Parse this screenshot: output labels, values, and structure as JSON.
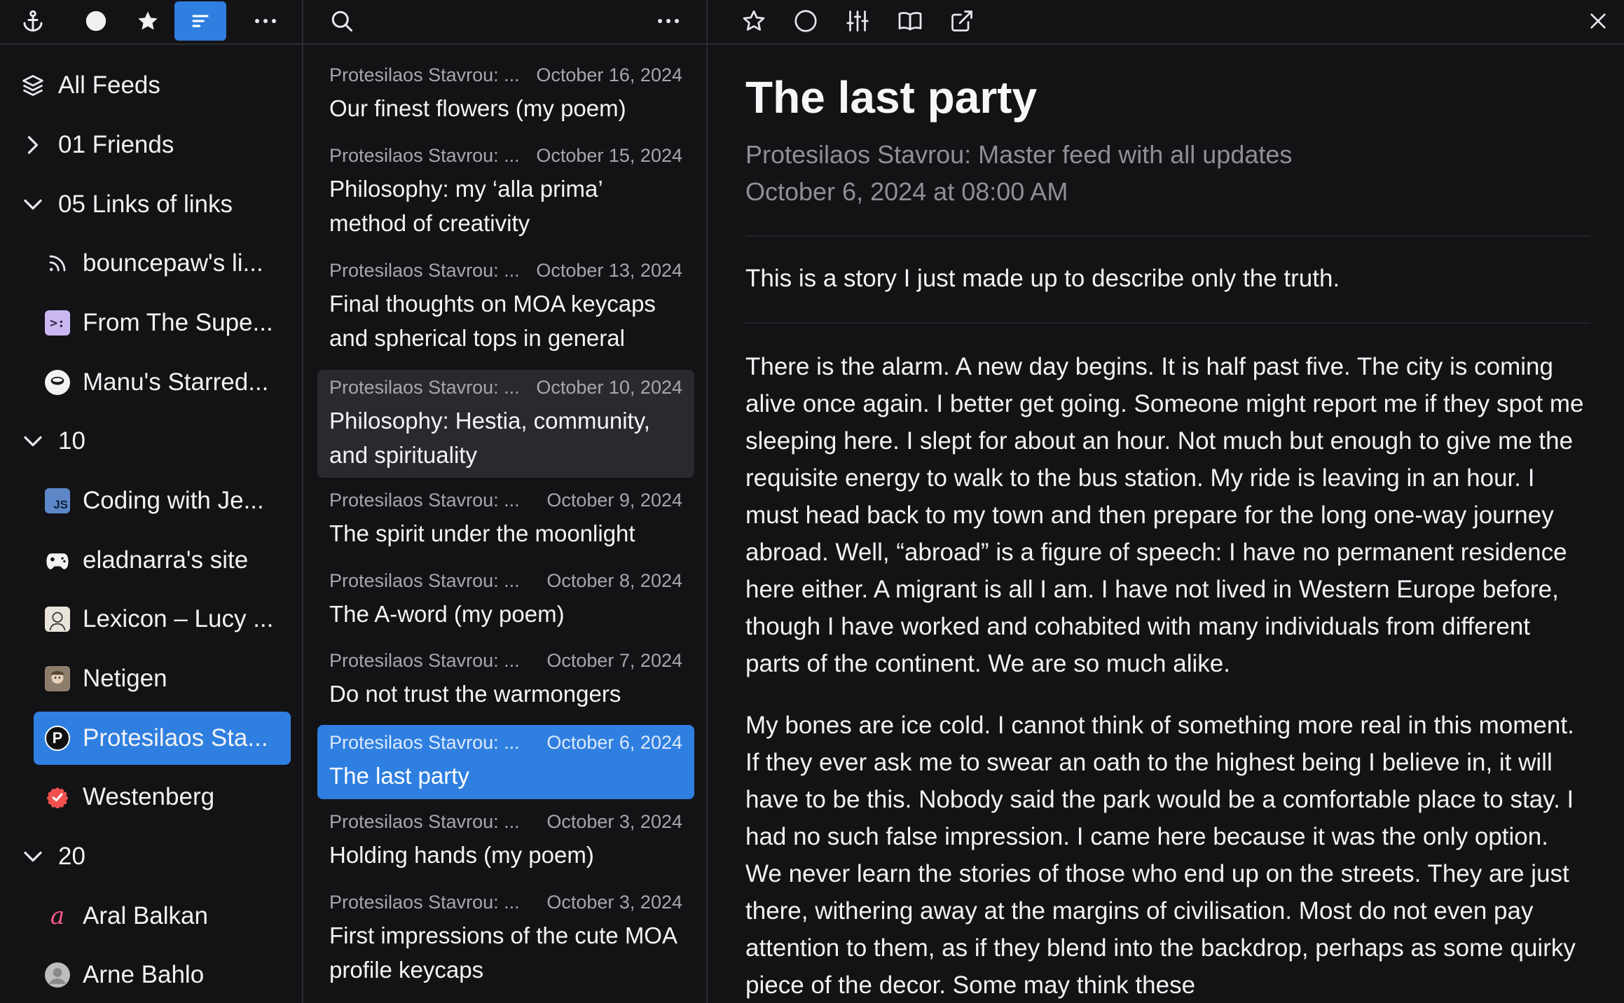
{
  "sidebar": {
    "all_feeds": "All Feeds",
    "rows": [
      {
        "label": "01 Friends"
      },
      {
        "label": "05 Links of links"
      },
      {
        "label": "bouncepaw's li..."
      },
      {
        "label": "From The Supe..."
      },
      {
        "label": "Manu's Starred..."
      },
      {
        "label": "10"
      },
      {
        "label": "Coding with Je..."
      },
      {
        "label": "eladnarra's site"
      },
      {
        "label": "Lexicon – Lucy ..."
      },
      {
        "label": "Netigen"
      },
      {
        "label": "Protesilaos Sta..."
      },
      {
        "label": "Westenberg"
      },
      {
        "label": "20"
      },
      {
        "label": "Aral Balkan"
      },
      {
        "label": "Arne Bahlo"
      }
    ]
  },
  "list": {
    "articles": [
      {
        "source": "Protesilaos Stavrou: ...",
        "date": "October 16, 2024",
        "title": "Our finest flowers (my poem)"
      },
      {
        "source": "Protesilaos Stavrou: ...",
        "date": "October 15, 2024",
        "title": "Philosophy: my ‘alla prima’ method of creativity"
      },
      {
        "source": "Protesilaos Stavrou: ...",
        "date": "October 13, 2024",
        "title": "Final thoughts on MOA keycaps and spherical tops in general"
      },
      {
        "source": "Protesilaos Stavrou: ...",
        "date": "October 10, 2024",
        "title": "Philosophy: Hestia, community, and spirituality"
      },
      {
        "source": "Protesilaos Stavrou: ...",
        "date": "October 9, 2024",
        "title": "The spirit under the moonlight"
      },
      {
        "source": "Protesilaos Stavrou: ...",
        "date": "October 8, 2024",
        "title": "The A-word (my poem)"
      },
      {
        "source": "Protesilaos Stavrou: ...",
        "date": "October 7, 2024",
        "title": "Do not trust the warmongers"
      },
      {
        "source": "Protesilaos Stavrou: ...",
        "date": "October 6, 2024",
        "title": "The last party"
      },
      {
        "source": "Protesilaos Stavrou: ...",
        "date": "October 3, 2024",
        "title": "Holding hands (my poem)"
      },
      {
        "source": "Protesilaos Stavrou: ...",
        "date": "October 3, 2024",
        "title": "First impressions of the cute MOA profile keycaps"
      }
    ]
  },
  "reader": {
    "title": "The last party",
    "feed": "Protesilaos Stavrou: Master feed with all updates",
    "date": "October 6, 2024 at 08:00 AM",
    "lede": "This is a story I just made up to describe only the truth.",
    "p1": "There is the alarm. A new day begins. It is half past five. The city is coming alive once again. I better get going. Someone might report me if they spot me sleeping here. I slept for about an hour. Not much but enough to give me the requisite energy to walk to the bus station. My ride is leaving in an hour. I must head back to my town and then prepare for the long one-way journey abroad. Well, “abroad” is a figure of speech: I have no permanent residence here either. A migrant is all I am. I have not lived in Western Europe before, though I have worked and cohabited with many individuals from different parts of the continent. We are so much alike.",
    "p2": "My bones are ice cold. I cannot think of something more real in this moment. If they ever ask me to swear an oath to the highest being I believe in, it will have to be this. Nobody said the park would be a comfortable place to stay. I had no such false impression. I came here because it was the only option. We never learn the stories of those who end up on the streets. They are just there, withering away at the margins of civilisation. Most do not even pay attention to them, as if they blend into the backdrop, perhaps as some quirky piece of the decor. Some may think these"
  },
  "colors": {
    "accent": "#2f7fe0",
    "background": "#131316",
    "hover": "#2a2a2e",
    "muted_text": "#8f8f96"
  }
}
